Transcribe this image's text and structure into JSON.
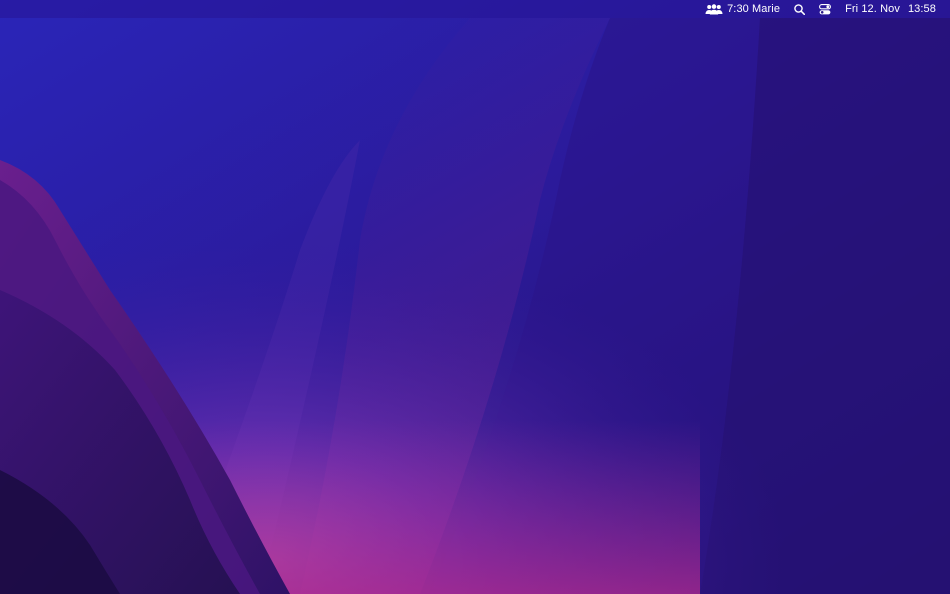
{
  "menubar": {
    "family": {
      "icon": "people-icon",
      "label": "7:30 Marie"
    },
    "search": {
      "icon": "search-icon"
    },
    "control_center": {
      "icon": "control-center-icon"
    },
    "date": "Fri 12. Nov",
    "time": "13:58"
  },
  "wallpaper": {
    "name": "macOS Monterey",
    "colors": {
      "top_left": "#2b22b8",
      "deep": "#261269",
      "ridge": "#4a1b8c",
      "glow": "#a05ad0",
      "magenta": "#8a2a9c"
    }
  }
}
